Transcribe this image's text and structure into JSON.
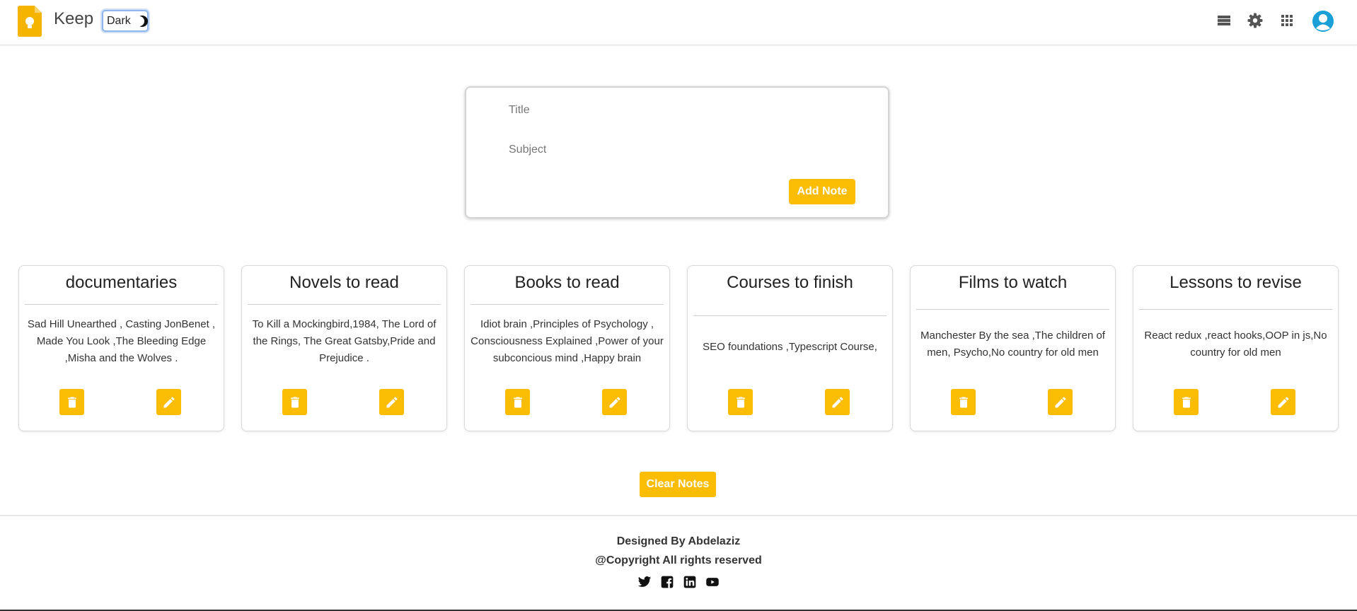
{
  "header": {
    "brand": "Keep",
    "dark_toggle_label": "Dark",
    "icons": [
      "list-view-icon",
      "settings-gear-icon",
      "apps-grid-icon",
      "account-avatar"
    ]
  },
  "form": {
    "title_placeholder": "Title",
    "subject_placeholder": "Subject",
    "add_button": "Add Note"
  },
  "notes": [
    {
      "title": "documentaries",
      "body": "Sad Hill Unearthed , Casting JonBenet , Made You Look ,The Bleeding Edge ,Misha and the Wolves ."
    },
    {
      "title": "Novels to read",
      "body": "To Kill a Mockingbird,1984, The Lord of the Rings, The Great Gatsby,Pride and Prejudice ."
    },
    {
      "title": "Books to read",
      "body": "Idiot brain ,Principles of Psychology , Consciousness Explained ,Power of your subconcious mind ,Happy brain"
    },
    {
      "title": "Courses to finish",
      "body": "SEO foundations ,Typescript Course,"
    },
    {
      "title": "Films to watch",
      "body": "Manchester By the sea ,The children of men, Psycho,No country for old men"
    },
    {
      "title": "Lessons to revise",
      "body": "React redux ,react hooks,OOP in js,No country for old men"
    }
  ],
  "clear_button": "Clear Notes",
  "footer": {
    "designed_by": "Designed By Abdelaziz",
    "copyright": "@Copyright All rights reserved",
    "socials": [
      "twitter-icon",
      "facebook-icon",
      "linkedin-icon",
      "youtube-icon"
    ]
  },
  "colors": {
    "accent": "#fbbc04",
    "logo": "#f4b400"
  }
}
